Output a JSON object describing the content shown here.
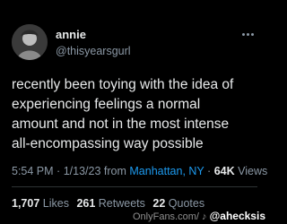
{
  "tweet": {
    "display_name": "annie",
    "handle": "@thisyearsgurl",
    "text_lines": [
      "recently been toying with the idea of",
      "experiencing feelings a normal",
      "amount and not in the most intense",
      "all-encompassing way possible"
    ],
    "time": "5:54 PM",
    "date": "1/13/23",
    "from_word": "from",
    "location": "Manhattan, NY",
    "views_count": "64K",
    "views_label": "Views",
    "separator": "·"
  },
  "stats": {
    "likes_count": "1,707",
    "likes_label": "Likes",
    "retweets_count": "261",
    "retweets_label": "Retweets",
    "quotes_count": "22",
    "quotes_label": "Quotes"
  },
  "watermark": {
    "site": "OnlyFans.com/",
    "user": "@ahecksis"
  },
  "colors": {
    "background": "#000000",
    "text": "#e7e9ea",
    "muted": "#8b98a5",
    "link": "#1d9bf0"
  },
  "icons": {
    "more": "more-horizontal-icon",
    "tiktok": "tiktok-icon"
  }
}
